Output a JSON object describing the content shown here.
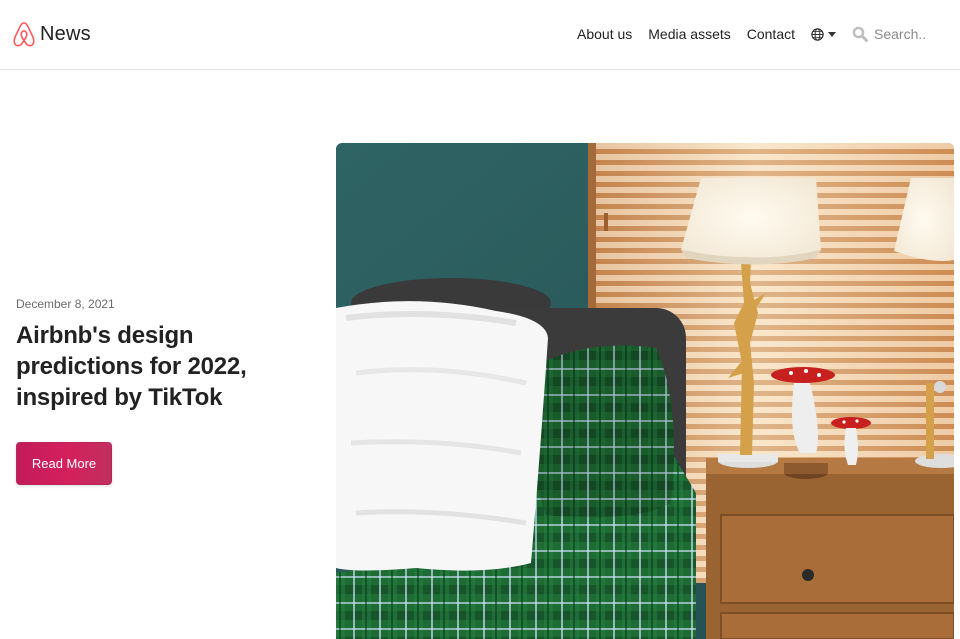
{
  "header": {
    "brand": "News",
    "nav": [
      "About us",
      "Media assets",
      "Contact"
    ],
    "search_placeholder": "Search.."
  },
  "hero": {
    "date": "December 8, 2021",
    "title_lines": [
      "Airbnb's design",
      "predictions for 2022,",
      "inspired by TikTok"
    ],
    "cta": "Read More",
    "image": "bedroom-scene-photo"
  },
  "colors": {
    "brand": "#ff5a5f",
    "cta": "#d21f5b",
    "wall": "#2e5d5f",
    "wood": "#a86a35"
  }
}
